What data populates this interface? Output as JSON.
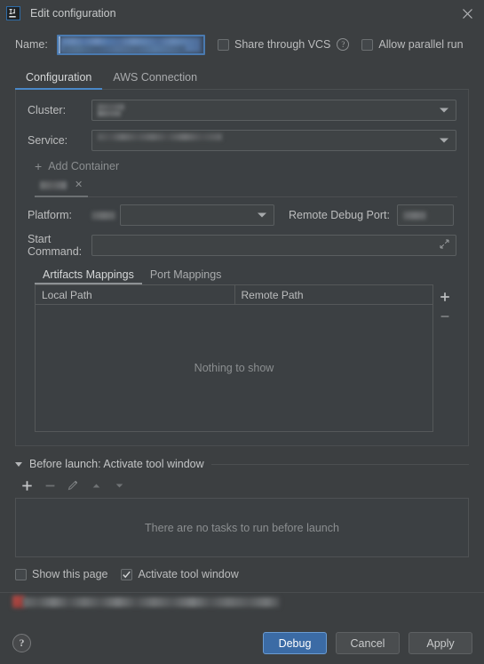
{
  "window": {
    "title": "Edit configuration",
    "app_icon": "intellij-idea-icon",
    "close_icon": "close-icon"
  },
  "name_row": {
    "label": "Name:",
    "value": "",
    "value_redacted": true,
    "share_vcs": {
      "label": "Share through VCS",
      "checked": false
    },
    "help_icon": "help-icon",
    "allow_parallel": {
      "label": "Allow parallel run",
      "checked": false
    }
  },
  "main_tabs": {
    "items": [
      {
        "label": "Configuration",
        "active": true
      },
      {
        "label": "AWS Connection",
        "active": false
      }
    ],
    "accent": "#4a88c7"
  },
  "configuration": {
    "cluster": {
      "label": "Cluster:",
      "value": "",
      "value_redacted": true
    },
    "service": {
      "label": "Service:",
      "value": "",
      "value_redacted": true
    },
    "add_container": {
      "label": "Add Container",
      "icon": "plus-icon"
    },
    "container_tabs": [
      {
        "label": "",
        "label_redacted": true,
        "close_icon": "close-icon",
        "active": true
      }
    ],
    "platform": {
      "label": "Platform:",
      "prefix_value": "",
      "prefix_redacted": true,
      "value": ""
    },
    "remote_debug_port": {
      "label": "Remote Debug Port:",
      "value": "",
      "value_redacted": true
    },
    "start_command": {
      "label": "Start Command:",
      "value": "",
      "expand_icon": "expand-icon"
    },
    "mapping_tabs": [
      {
        "label": "Artifacts Mappings",
        "active": true
      },
      {
        "label": "Port Mappings",
        "active": false
      }
    ],
    "mappings_table": {
      "columns": [
        "Local Path",
        "Remote Path"
      ],
      "rows": [],
      "empty_text": "Nothing to show",
      "add_icon": "plus-icon",
      "remove_icon": "minus-icon"
    }
  },
  "before_launch": {
    "header": "Before launch: Activate tool window",
    "collapse_icon": "chevron-down-icon",
    "toolbar": [
      {
        "icon": "plus-icon",
        "enabled": true
      },
      {
        "icon": "minus-icon",
        "enabled": false
      },
      {
        "icon": "pencil-icon",
        "enabled": false
      },
      {
        "icon": "arrow-up-icon",
        "enabled": false
      },
      {
        "icon": "arrow-down-icon",
        "enabled": false
      }
    ],
    "empty_text": "There are no tasks to run before launch",
    "show_this_page": {
      "label": "Show this page",
      "checked": false
    },
    "activate_tool_window": {
      "label": "Activate tool window",
      "checked": true
    }
  },
  "error_strip": {
    "message": "",
    "message_redacted": true,
    "icon": "error-icon",
    "color": "#b84b46"
  },
  "footer": {
    "help_label": "?",
    "buttons": [
      {
        "label": "Debug",
        "primary": true
      },
      {
        "label": "Cancel",
        "primary": false
      },
      {
        "label": "Apply",
        "primary": false
      }
    ]
  }
}
